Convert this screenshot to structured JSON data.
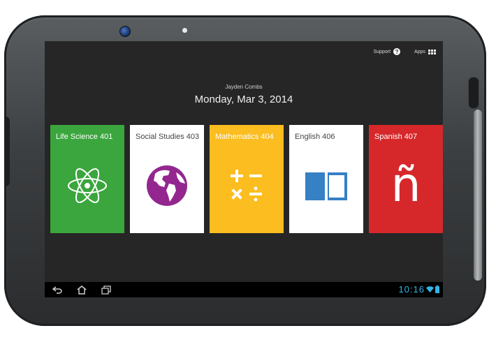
{
  "header": {
    "support_label": "Support",
    "support_icon": "?",
    "apps_label": "Apps"
  },
  "user": {
    "name": "Jayden Combs"
  },
  "date": "Monday, Mar 3, 2014",
  "courses": [
    {
      "title": "Life Science 401",
      "color": "#3aa63d",
      "text_color": "#ffffff",
      "icon": "atom-icon"
    },
    {
      "title": "Social Studies 403",
      "color": "#ffffff",
      "text_color": "#444444",
      "icon": "globe-icon",
      "icon_color": "#93278f"
    },
    {
      "title": "Mathematics 404",
      "color": "#fbbd1f",
      "text_color": "#ffffff",
      "icon": "math-operators-icon"
    },
    {
      "title": "English 406",
      "color": "#ffffff",
      "text_color": "#444444",
      "icon": "book-icon",
      "icon_color": "#3680c4"
    },
    {
      "title": "Spanish 407",
      "color": "#d6282b",
      "text_color": "#ffffff",
      "icon": "n-tilde-icon",
      "glyph": "ñ"
    }
  ],
  "status_bar": {
    "time": "10:16",
    "accent": "#33b5e5"
  }
}
